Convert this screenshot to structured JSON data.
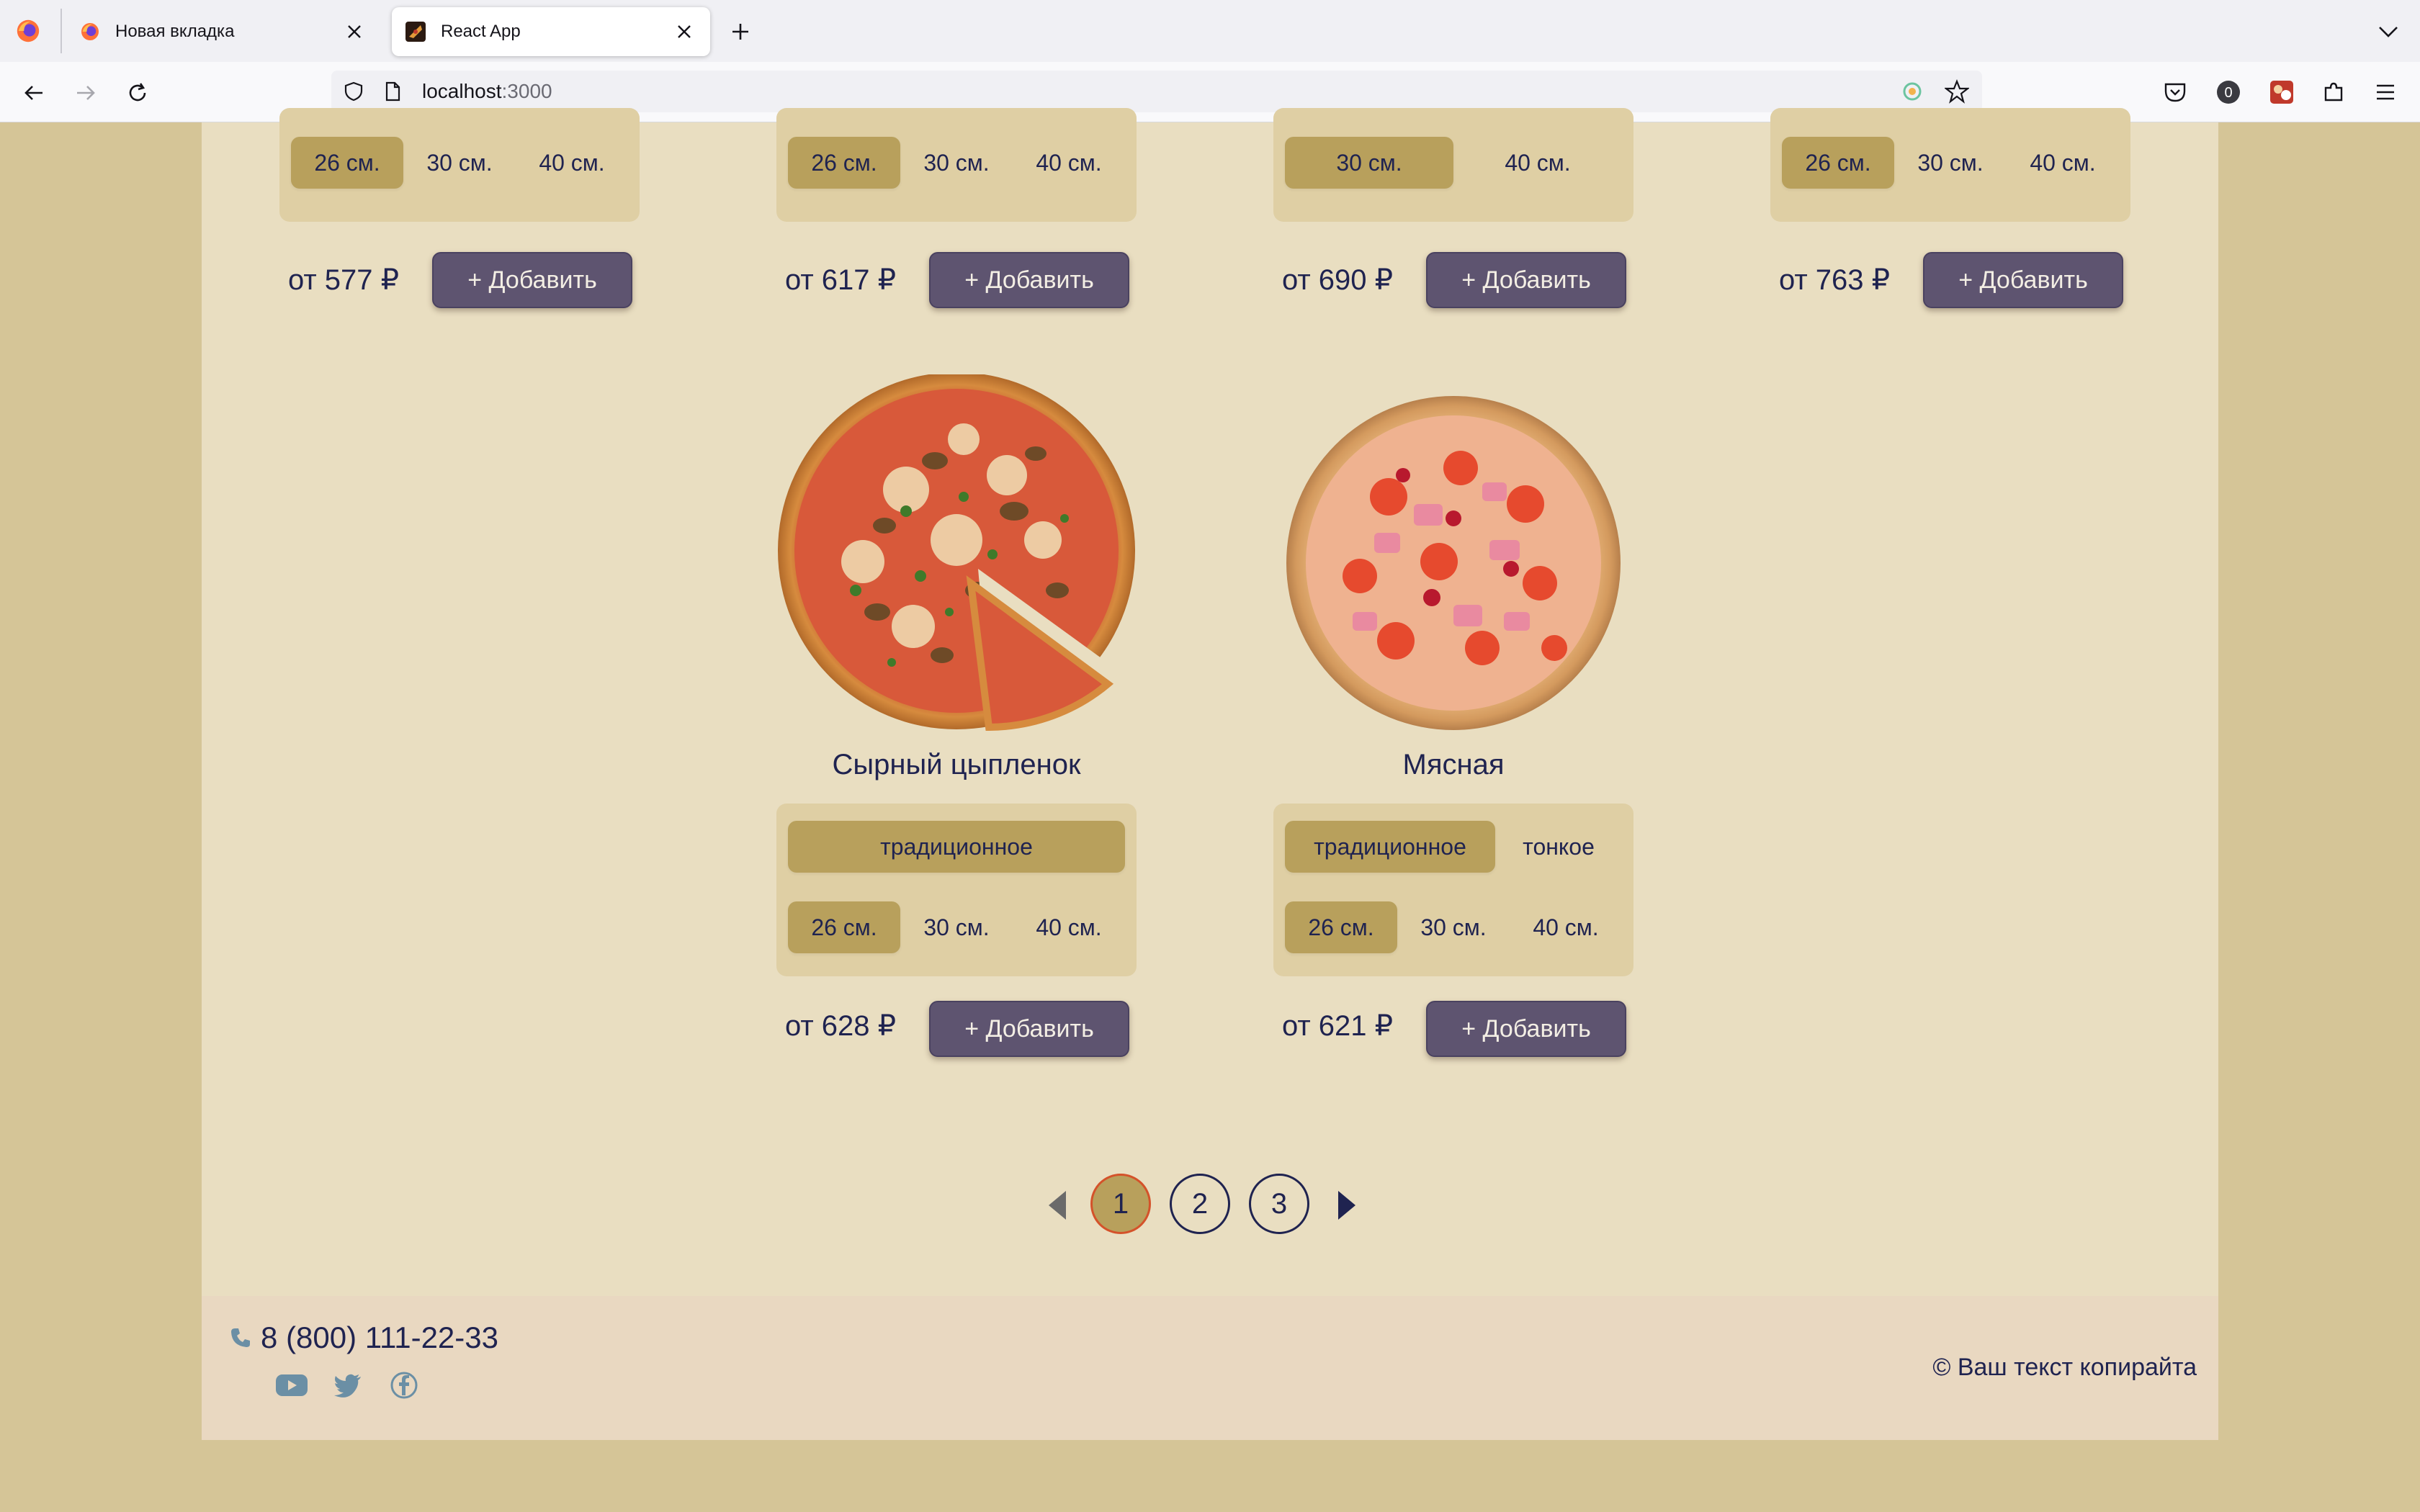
{
  "browser": {
    "tabs": [
      {
        "title": "Новая вкладка",
        "active": false
      },
      {
        "title": "React App",
        "active": true
      }
    ],
    "url_host": "localhost",
    "url_port": ":3000",
    "extension_badge": "0"
  },
  "top_row": [
    {
      "sizes": [
        "26 см.",
        "30 см.",
        "40 см."
      ],
      "active_size": 0,
      "price": "от 577 ₽",
      "add_label": "+ Добавить"
    },
    {
      "sizes": [
        "26 см.",
        "30 см.",
        "40 см."
      ],
      "active_size": 0,
      "price": "от 617 ₽",
      "add_label": "+ Добавить"
    },
    {
      "sizes": [
        "30 см.",
        "40 см."
      ],
      "active_size": 0,
      "price": "от 690 ₽",
      "add_label": "+ Добавить"
    },
    {
      "sizes": [
        "26 см.",
        "30 см.",
        "40 см."
      ],
      "active_size": 0,
      "price": "от 763 ₽",
      "add_label": "+ Добавить"
    }
  ],
  "pizzas": [
    {
      "name": "Сырный цыпленок",
      "types": [
        "традиционное"
      ],
      "sizes": [
        "26 см.",
        "30 см.",
        "40 см."
      ],
      "price": "от 628 ₽",
      "add_label": "+ Добавить"
    },
    {
      "name": "Мясная",
      "types": [
        "традиционное",
        "тонкое"
      ],
      "sizes": [
        "26 см.",
        "30 см.",
        "40 см."
      ],
      "price": "от 621 ₽",
      "add_label": "+ Добавить"
    }
  ],
  "pagination": {
    "pages": [
      "1",
      "2",
      "3"
    ],
    "current": "1"
  },
  "footer": {
    "phone": "8 (800) 111-22-33",
    "copyright": "© Ваш текст копирайта",
    "socials": [
      "youtube-icon",
      "twitter-icon",
      "facebook-icon"
    ]
  },
  "colors": {
    "page_bg": "#d5c597",
    "panel_bg": "#e9dec1",
    "selector_bg": "#dfcfa4",
    "option_active": "#b8a05c",
    "button_bg": "#5e5470",
    "text": "#1f2350",
    "footer_bg": "#e9d8c1"
  }
}
